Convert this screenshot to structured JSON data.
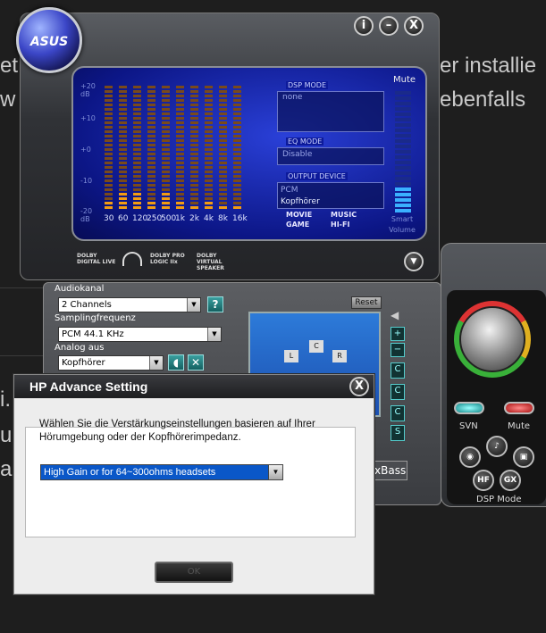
{
  "background": {
    "lines": [
      "et",
      "w",
      "er installie",
      "ebenfalls",
      "i.",
      "u",
      "al"
    ]
  },
  "main": {
    "logo": "ASUS",
    "title_buttons": [
      "i",
      "–",
      "X"
    ],
    "mute_label": "Mute",
    "eq": {
      "y_ticks": [
        "+20 dB",
        "+10",
        "+0",
        "-10",
        "-20 dB"
      ],
      "bands": [
        "30",
        "60",
        "120",
        "250",
        "500",
        "1k",
        "2k",
        "4k",
        "8k",
        "16k"
      ],
      "levels_db": [
        -17,
        -14,
        -14,
        -17,
        -14,
        -16,
        -18,
        -16,
        -18,
        -18
      ]
    },
    "dsp_mode": {
      "title": "DSP MODE",
      "value": "none"
    },
    "eq_mode": {
      "title": "EQ MODE",
      "value": "Disable"
    },
    "output_device": {
      "title": "OUTPUT DEVICE",
      "options": [
        "PCM",
        "Kopfhörer"
      ],
      "selected": "Kopfhörer"
    },
    "modes": [
      "MOVIE",
      "MUSIC",
      "GAME",
      "HI-FI"
    ],
    "smart_volume": "Smart Volume",
    "dolby_badges": [
      "DOLBY DIGITAL LIVE",
      "DOLBY PRO LOGIC IIx",
      "DOLBY VIRTUAL SPEAKER"
    ]
  },
  "controls": {
    "audiokanal_label": "Audiokanal",
    "audiokanal_value": "2 Channels",
    "help": "?",
    "sampling_label": "Samplingfrequenz",
    "sampling_value": "PCM 44.1 KHz",
    "analog_label": "Analog aus",
    "analog_value": "Kopfhörer",
    "reset": "Reset",
    "speakers": [
      "C",
      "L",
      "R"
    ],
    "bass_label": "xBass"
  },
  "dsp_panel": {
    "svn": "SVN",
    "mute": "Mute",
    "dsp_mode_label": "DSP Mode",
    "buttons": [
      "HF",
      "GX"
    ]
  },
  "dialog": {
    "title": "HP Advance Setting",
    "close": "X",
    "description": "Wählen Sie die Verstärkungseinstellungen basieren auf Ihrer Hörumgebung oder der Kopfhörerimpedanz.",
    "gain_value": "High Gain or for 64~300ohms headsets",
    "ok": "OK"
  },
  "colors": {
    "accent": "#0a57c8",
    "eq_low": "#f39c12",
    "eq_dim": "#7a4a1a"
  }
}
